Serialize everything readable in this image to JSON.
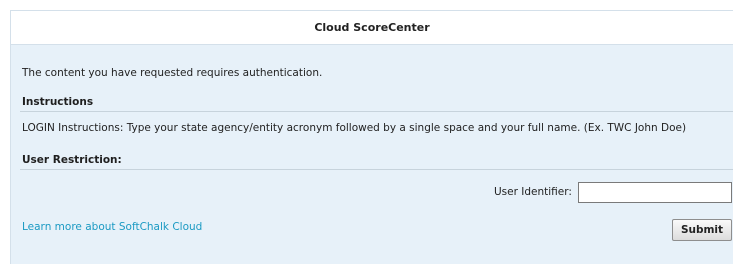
{
  "header": {
    "title": "Cloud ScoreCenter"
  },
  "message": "The content you have requested requires authentication.",
  "instructions": {
    "heading": "Instructions",
    "text": "LOGIN Instructions: Type your state agency/entity acronym followed by a single space and your full name. (Ex. TWC John Doe)"
  },
  "restriction": {
    "heading": "User Restriction:",
    "identifier_label": "User Identifier:",
    "identifier_value": ""
  },
  "footer": {
    "learn_more_link": "Learn more about SoftChalk Cloud",
    "submit_label": "Submit"
  },
  "colors": {
    "panel_background": "#e7f1f9",
    "link": "#1b9ac3"
  }
}
